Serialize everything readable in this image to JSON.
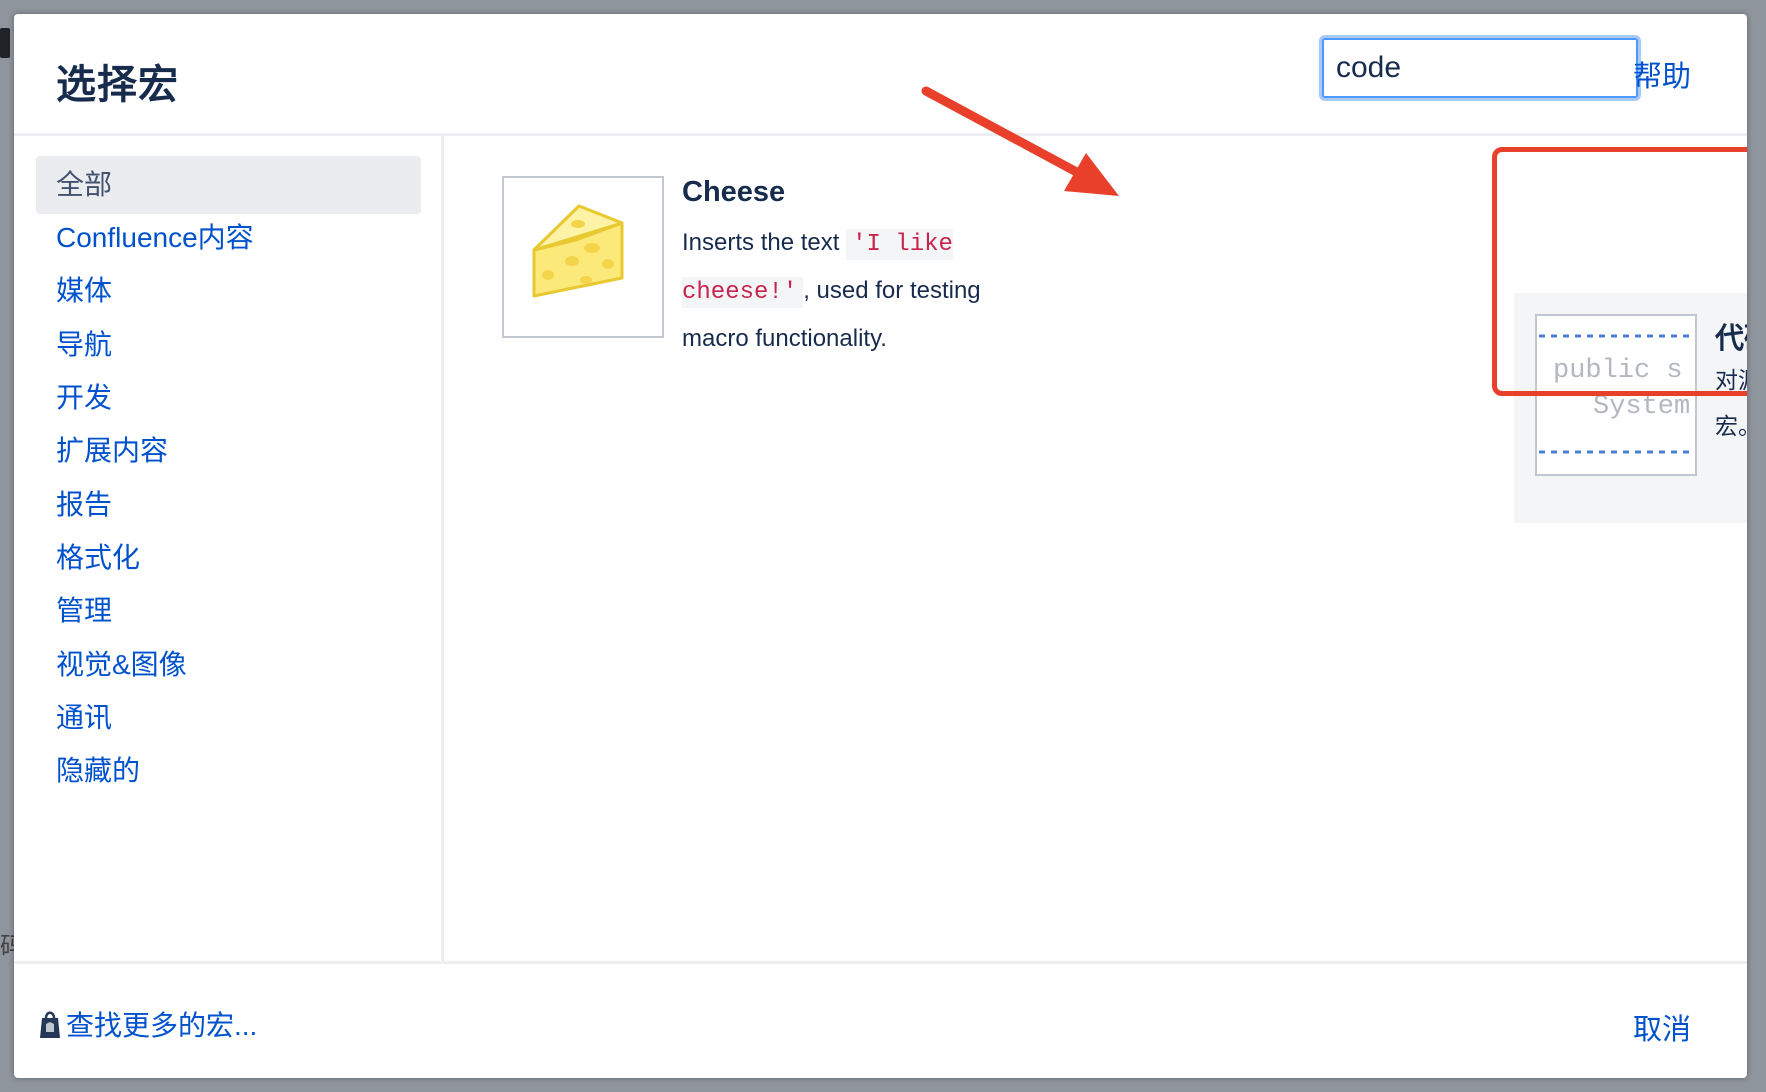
{
  "dialog": {
    "title": "选择宏",
    "search": {
      "value": "code"
    },
    "help_label": "帮助"
  },
  "sidebar": {
    "items": [
      {
        "label": "全部",
        "active": true
      },
      {
        "label": "Confluence内容"
      },
      {
        "label": "媒体"
      },
      {
        "label": "导航"
      },
      {
        "label": "开发"
      },
      {
        "label": "扩展内容"
      },
      {
        "label": "报告"
      },
      {
        "label": "格式化"
      },
      {
        "label": "管理"
      },
      {
        "label": "视觉&图像"
      },
      {
        "label": "通讯"
      },
      {
        "label": "隐藏的"
      }
    ]
  },
  "results": [
    {
      "title": "Cheese",
      "desc_before": "Inserts the text",
      "desc_code": "'I like cheese!'",
      "desc_after": ", used for testing macro functionality.",
      "icon": "cheese-icon"
    },
    {
      "title": "代码块",
      "desc": "对源代码或XML块进行格式化的宏。",
      "thumb_line1": "public s",
      "thumb_line2": "System",
      "icon": "code-block-thumbnail"
    }
  ],
  "footer": {
    "find_more_label": "查找更多的宏...",
    "cancel_label": "取消"
  },
  "colors": {
    "link": "#0052cc",
    "title": "#172b4d",
    "highlight": "#e8402a",
    "focus_ring": "#4c9aff"
  },
  "backdrop": {
    "glyph": "码"
  }
}
